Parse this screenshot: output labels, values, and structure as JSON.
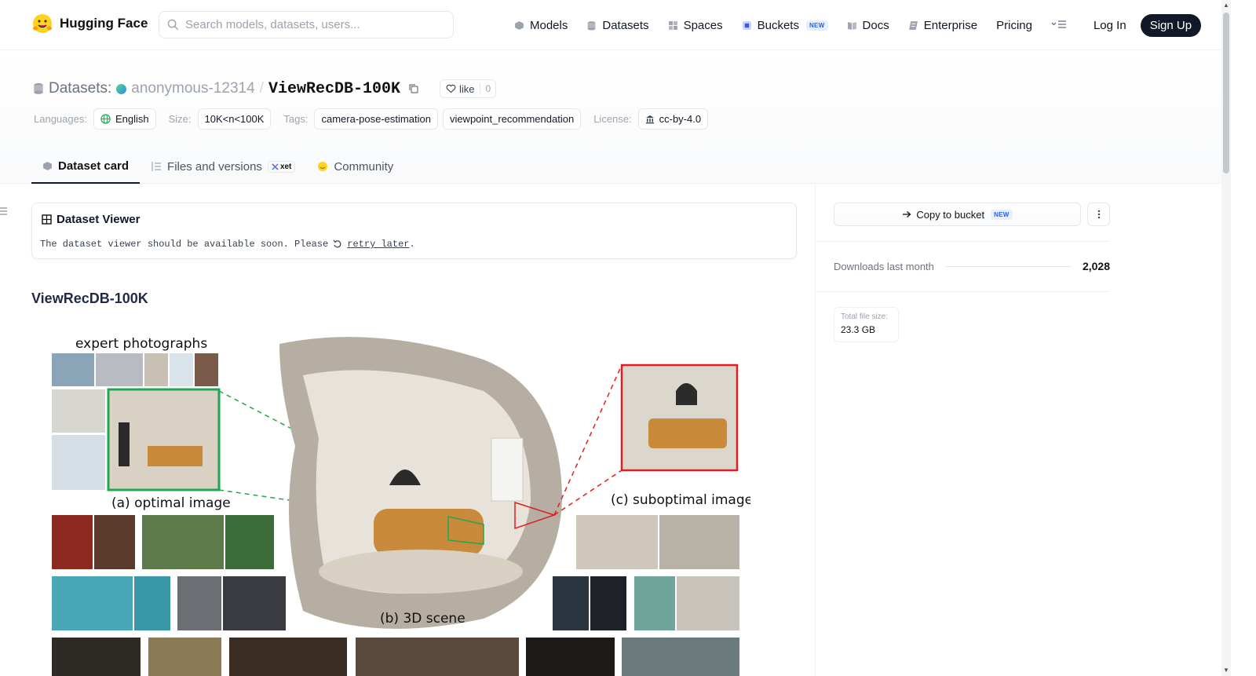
{
  "nav": {
    "brand": "Hugging Face",
    "search_placeholder": "Search models, datasets, users...",
    "links": [
      {
        "label": "Models",
        "icon": "models-icon"
      },
      {
        "label": "Datasets",
        "icon": "datasets-icon"
      },
      {
        "label": "Spaces",
        "icon": "spaces-icon"
      },
      {
        "label": "Buckets",
        "icon": "buckets-icon",
        "badge": "NEW"
      },
      {
        "label": "Docs",
        "icon": "docs-icon"
      },
      {
        "label": "Enterprise",
        "icon": "enterprise-icon"
      },
      {
        "label": "Pricing"
      }
    ],
    "login": "Log In",
    "signup": "Sign Up"
  },
  "repo": {
    "section": "Datasets:",
    "owner": "anonymous-12314",
    "separator": "/",
    "name": "ViewRecDB-100K",
    "like_label": "like",
    "like_count": "0"
  },
  "meta": {
    "languages_label": "Languages:",
    "language": "English",
    "size_label": "Size:",
    "size": "10K<n<100K",
    "tags_label": "Tags:",
    "tags": [
      "camera-pose-estimation",
      "viewpoint_recommendation"
    ],
    "license_label": "License:",
    "license": "cc-by-4.0"
  },
  "tabs": [
    {
      "label": "Dataset card",
      "active": true
    },
    {
      "label": "Files and versions",
      "badge": "xet"
    },
    {
      "label": "Community"
    }
  ],
  "viewer": {
    "title": "Dataset Viewer",
    "message": "The dataset viewer should be available soon. Please",
    "retry": "retry later",
    "end": "."
  },
  "card": {
    "heading": "ViewRecDB-100K",
    "figure": {
      "label_expert": "expert photographs",
      "label_optimal": "(a) optimal image",
      "label_scene": "(b) 3D scene",
      "label_suboptimal": "(c) suboptimal image"
    }
  },
  "sidebar": {
    "copy_label": "Copy to bucket",
    "copy_badge": "NEW",
    "downloads_label": "Downloads last month",
    "downloads_value": "2,028",
    "filesize_label": "Total file size:",
    "filesize_value": "23.3 GB"
  },
  "colors": {
    "optimal_frame": "#22a652",
    "suboptimal_frame": "#e11d1d",
    "signup_bg": "#111827"
  }
}
